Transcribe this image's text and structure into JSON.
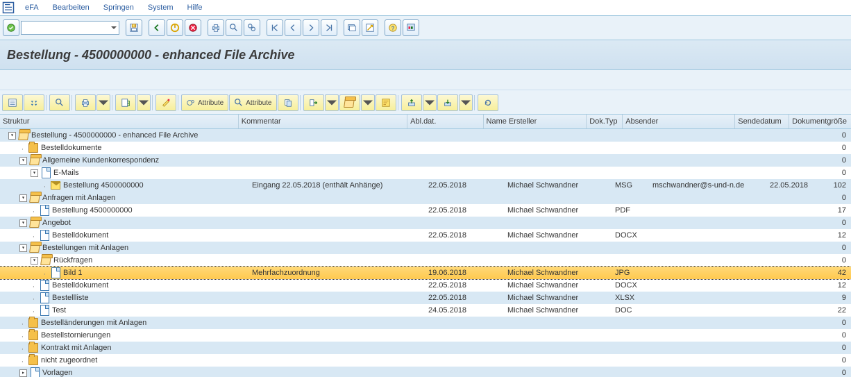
{
  "menubar": {
    "items": [
      "eFA",
      "Bearbeiten",
      "Springen",
      "System",
      "Hilfe"
    ]
  },
  "title": "Bestellung - 4500000000 - enhanced File Archive",
  "attr_toolbar": {
    "attr1": "Attribute",
    "attr2": "Attribute"
  },
  "columns": {
    "struct": "Struktur",
    "comment": "Kommentar",
    "date": "Abl.dat.",
    "creator": "Name Ersteller",
    "type": "Dok.Typ",
    "sender": "Absender",
    "sentdate": "Sendedatum",
    "size": "Dokumentgröße"
  },
  "rows": [
    {
      "level": 0,
      "exp": "▼",
      "icon": "folder-open",
      "label": "Bestellung - 4500000000 - enhanced File Archive",
      "comment": "",
      "date": "",
      "creator": "",
      "type": "",
      "sender": "",
      "sentdate": "",
      "size": "0",
      "alt": true
    },
    {
      "level": 1,
      "dot": true,
      "icon": "folder-closed",
      "label": "Bestelldokumente",
      "size": "0",
      "alt": false
    },
    {
      "level": 1,
      "exp": "▼",
      "icon": "folder-open",
      "label": "Allgemeine Kundenkorrespondenz",
      "size": "0",
      "alt": true
    },
    {
      "level": 2,
      "exp": "▼",
      "icon": "doc",
      "label": "E-Mails",
      "size": "0",
      "alt": false
    },
    {
      "level": 3,
      "dot": true,
      "icon": "mail",
      "label": "Bestellung 4500000000",
      "comment": "Eingang 22.05.2018 (enthält Anhänge)",
      "date": "22.05.2018",
      "creator": "Michael Schwandner",
      "type": "MSG",
      "sender": "mschwandner@s-und-n.de",
      "sentdate": "22.05.2018",
      "size": "102",
      "alt": true
    },
    {
      "level": 1,
      "exp": "▼",
      "icon": "folder-open",
      "label": "Anfragen mit Anlagen",
      "size": "0",
      "alt": true
    },
    {
      "level": 2,
      "dot": true,
      "icon": "doc",
      "label": "Bestellung 4500000000",
      "date": "22.05.2018",
      "creator": "Michael Schwandner",
      "type": "PDF",
      "size": "17",
      "alt": false
    },
    {
      "level": 1,
      "exp": "▼",
      "icon": "folder-open",
      "label": "Angebot",
      "size": "0",
      "alt": true
    },
    {
      "level": 2,
      "dot": true,
      "icon": "doc",
      "label": "Bestelldokument",
      "date": "22.05.2018",
      "creator": "Michael Schwandner",
      "type": "DOCX",
      "size": "12",
      "alt": false
    },
    {
      "level": 1,
      "exp": "▼",
      "icon": "folder-open",
      "label": "Bestellungen mit Anlagen",
      "size": "0",
      "alt": true
    },
    {
      "level": 2,
      "exp": "▼",
      "icon": "folder-open",
      "label": "Rückfragen",
      "size": "0",
      "alt": false
    },
    {
      "level": 3,
      "dot": true,
      "icon": "doc",
      "label": "Bild 1",
      "comment": "Mehrfachzuordnung",
      "date": "19.06.2018",
      "creator": "Michael Schwandner",
      "type": "JPG",
      "size": "42",
      "sel": true
    },
    {
      "level": 2,
      "dot": true,
      "icon": "doc",
      "label": "Bestelldokument",
      "date": "22.05.2018",
      "creator": "Michael Schwandner",
      "type": "DOCX",
      "size": "12",
      "alt": false
    },
    {
      "level": 2,
      "dot": true,
      "icon": "doc",
      "label": "Bestellliste",
      "date": "22.05.2018",
      "creator": "Michael Schwandner",
      "type": "XLSX",
      "size": "9",
      "alt": true
    },
    {
      "level": 2,
      "dot": true,
      "icon": "doc",
      "label": "Test",
      "date": "24.05.2018",
      "creator": "Michael Schwandner",
      "type": "DOC",
      "size": "22",
      "alt": false
    },
    {
      "level": 1,
      "dot": true,
      "icon": "folder-closed",
      "label": "Bestelländerungen mit Anlagen",
      "size": "0",
      "alt": true
    },
    {
      "level": 1,
      "dot": true,
      "icon": "folder-closed",
      "label": "Bestellstornierungen",
      "size": "0",
      "alt": false
    },
    {
      "level": 1,
      "dot": true,
      "icon": "folder-closed",
      "label": "Kontrakt mit Anlagen",
      "size": "0",
      "alt": true
    },
    {
      "level": 1,
      "dot": true,
      "icon": "folder-closed",
      "label": "nicht zugeordnet",
      "size": "0",
      "alt": false
    },
    {
      "level": 1,
      "exp": "▶",
      "icon": "doc",
      "label": "Vorlagen",
      "size": "0",
      "alt": true
    }
  ]
}
